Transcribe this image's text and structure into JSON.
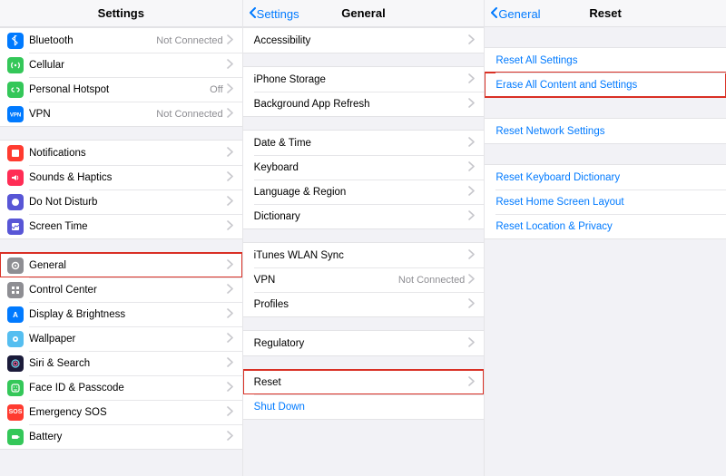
{
  "colors": {
    "accent": "#007aff",
    "highlight": "#d93025",
    "muted": "#8e8e93"
  },
  "pane1": {
    "title": "Settings",
    "group1": [
      {
        "label": "Bluetooth",
        "value": "Not Connected",
        "iconColor": "#007aff",
        "name": "bluetooth"
      },
      {
        "label": "Cellular",
        "value": "",
        "iconColor": "#34c759",
        "name": "cellular"
      },
      {
        "label": "Personal Hotspot",
        "value": "Off",
        "iconColor": "#34c759",
        "name": "personal-hotspot"
      },
      {
        "label": "VPN",
        "value": "Not Connected",
        "iconColor": "#007aff",
        "name": "vpn"
      }
    ],
    "group2": [
      {
        "label": "Notifications",
        "iconColor": "#ff3b30",
        "name": "notifications"
      },
      {
        "label": "Sounds & Haptics",
        "iconColor": "#ff2d55",
        "name": "sounds-haptics"
      },
      {
        "label": "Do Not Disturb",
        "iconColor": "#5856d6",
        "name": "do-not-disturb"
      },
      {
        "label": "Screen Time",
        "iconColor": "#5856d6",
        "name": "screen-time"
      }
    ],
    "group3": [
      {
        "label": "General",
        "iconColor": "#8e8e93",
        "name": "general",
        "highlight": true
      },
      {
        "label": "Control Center",
        "iconColor": "#8e8e93",
        "name": "control-center"
      },
      {
        "label": "Display & Brightness",
        "iconColor": "#007aff",
        "name": "display-brightness"
      },
      {
        "label": "Wallpaper",
        "iconColor": "#55bef0",
        "name": "wallpaper"
      },
      {
        "label": "Siri & Search",
        "iconColor": "#1b1b3a",
        "name": "siri-search"
      },
      {
        "label": "Face ID & Passcode",
        "iconColor": "#34c759",
        "name": "face-id-passcode"
      },
      {
        "label": "Emergency SOS",
        "iconColor": "#ff3b30",
        "name": "emergency-sos",
        "sosText": "SOS"
      },
      {
        "label": "Battery",
        "iconColor": "#34c759",
        "name": "battery"
      }
    ]
  },
  "pane2": {
    "back": "Settings",
    "title": "General",
    "group1": [
      {
        "label": "Accessibility",
        "name": "accessibility"
      }
    ],
    "group2": [
      {
        "label": "iPhone Storage",
        "name": "iphone-storage"
      },
      {
        "label": "Background App Refresh",
        "name": "background-app-refresh"
      }
    ],
    "group3": [
      {
        "label": "Date & Time",
        "name": "date-time"
      },
      {
        "label": "Keyboard",
        "name": "keyboard"
      },
      {
        "label": "Language & Region",
        "name": "language-region"
      },
      {
        "label": "Dictionary",
        "name": "dictionary"
      }
    ],
    "group4": [
      {
        "label": "iTunes WLAN Sync",
        "name": "itunes-wlan-sync"
      },
      {
        "label": "VPN",
        "value": "Not Connected",
        "name": "vpn-general"
      },
      {
        "label": "Profiles",
        "name": "profiles"
      }
    ],
    "group5": [
      {
        "label": "Regulatory",
        "name": "regulatory"
      }
    ],
    "group6": [
      {
        "label": "Reset",
        "name": "reset",
        "highlight": true
      },
      {
        "label": "Shut Down",
        "name": "shut-down",
        "link": true,
        "noChev": true
      }
    ]
  },
  "pane3": {
    "back": "General",
    "title": "Reset",
    "group1": [
      {
        "label": "Reset All Settings",
        "name": "reset-all-settings",
        "link": true,
        "noChev": true
      },
      {
        "label": "Erase All Content and Settings",
        "name": "erase-all-content-and-settings",
        "link": true,
        "noChev": true,
        "highlight": true
      }
    ],
    "group2": [
      {
        "label": "Reset Network Settings",
        "name": "reset-network-settings",
        "link": true,
        "noChev": true
      }
    ],
    "group3": [
      {
        "label": "Reset Keyboard Dictionary",
        "name": "reset-keyboard-dictionary",
        "link": true,
        "noChev": true
      },
      {
        "label": "Reset Home Screen Layout",
        "name": "reset-home-screen-layout",
        "link": true,
        "noChev": true
      },
      {
        "label": "Reset Location & Privacy",
        "name": "reset-location-privacy",
        "link": true,
        "noChev": true
      }
    ]
  }
}
